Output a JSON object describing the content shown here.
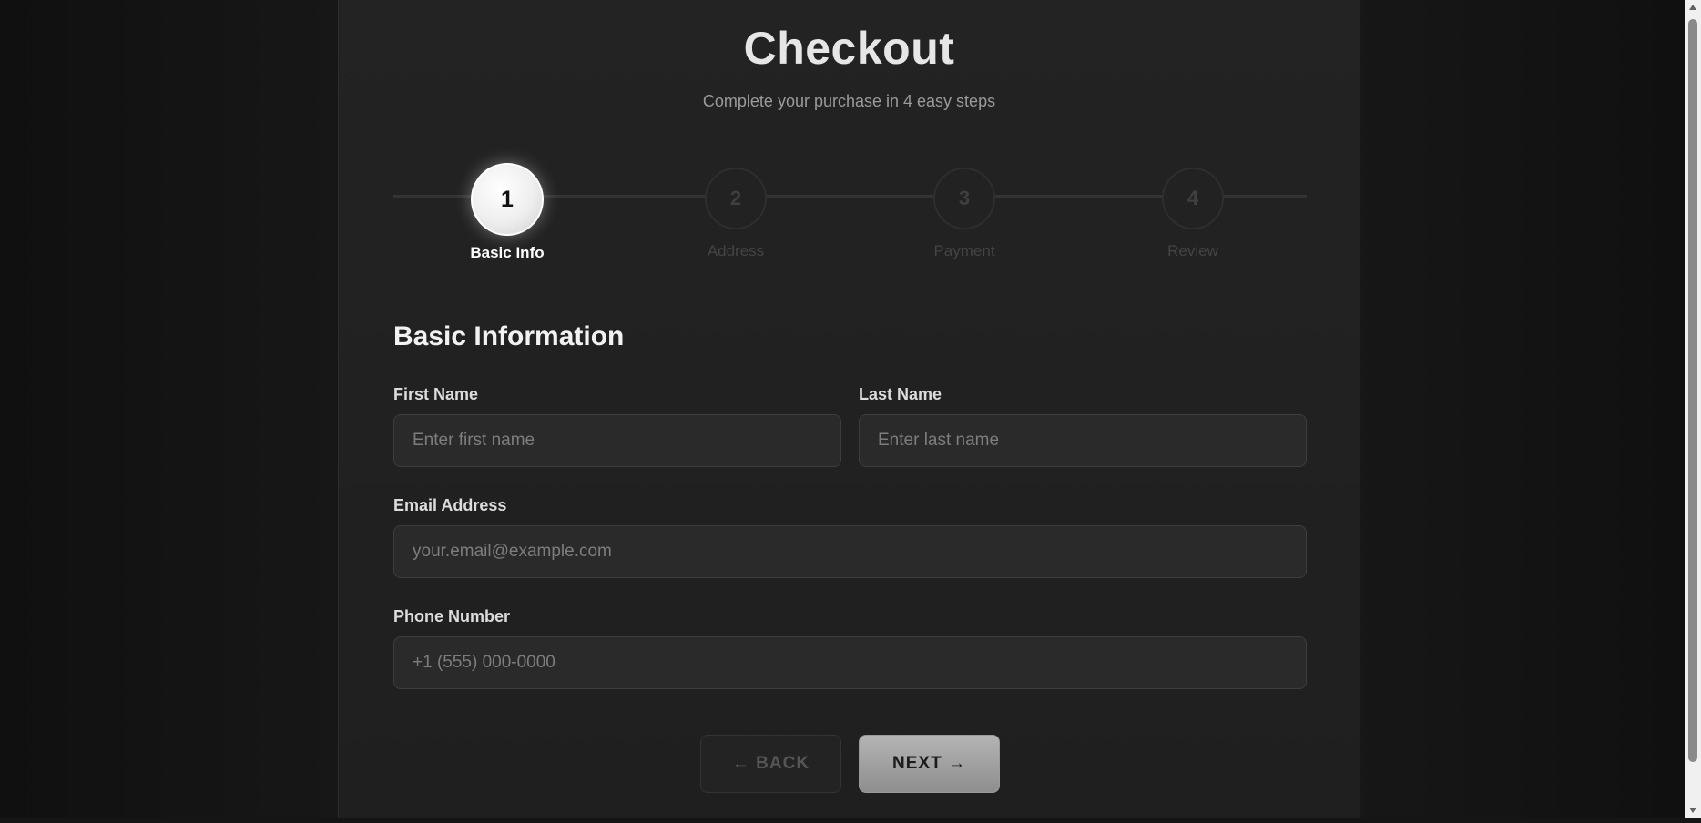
{
  "header": {
    "title": "Checkout",
    "subtitle": "Complete your purchase in 4 easy steps"
  },
  "steps": [
    {
      "number": "1",
      "label": "Basic Info",
      "active": true
    },
    {
      "number": "2",
      "label": "Address",
      "active": false
    },
    {
      "number": "3",
      "label": "Payment",
      "active": false
    },
    {
      "number": "4",
      "label": "Review",
      "active": false
    }
  ],
  "form": {
    "section_title": "Basic Information",
    "first_name": {
      "label": "First Name",
      "placeholder": "Enter first name",
      "value": ""
    },
    "last_name": {
      "label": "Last Name",
      "placeholder": "Enter last name",
      "value": ""
    },
    "email": {
      "label": "Email Address",
      "placeholder": "your.email@example.com",
      "value": ""
    },
    "phone": {
      "label": "Phone Number",
      "placeholder": "+1 (555) 000-0000",
      "value": ""
    }
  },
  "buttons": {
    "back_label": "← BACK",
    "next_label": "NEXT →"
  },
  "scrollbar": {
    "up_icon": "triangle-up-icon",
    "down_icon": "triangle-down-icon"
  }
}
